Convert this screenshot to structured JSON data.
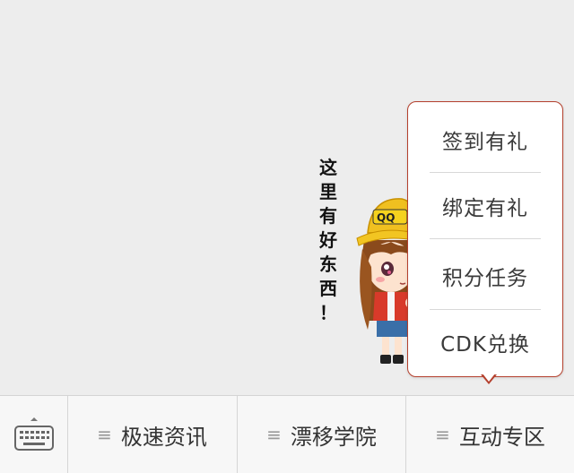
{
  "caption": {
    "chars": [
      "这",
      "里",
      "有",
      "好",
      "东",
      "西",
      "！"
    ]
  },
  "popup_menu": {
    "items": [
      {
        "label": "签到有礼"
      },
      {
        "label": "绑定有礼"
      },
      {
        "label": "积分任务"
      },
      {
        "label": "CDK兑换"
      }
    ]
  },
  "mascot": {
    "hat_text": "QQ"
  },
  "bottom_bar": {
    "keyboard_icon": "keyboard-icon",
    "tabs": [
      {
        "label": "极速资讯",
        "icon": "menu-lines-icon"
      },
      {
        "label": "漂移学院",
        "icon": "menu-lines-icon"
      },
      {
        "label": "互动专区",
        "icon": "menu-lines-icon"
      }
    ]
  },
  "colors": {
    "popup_border": "#b4402d",
    "background": "#ededed",
    "bar_background": "#f7f7f7"
  }
}
